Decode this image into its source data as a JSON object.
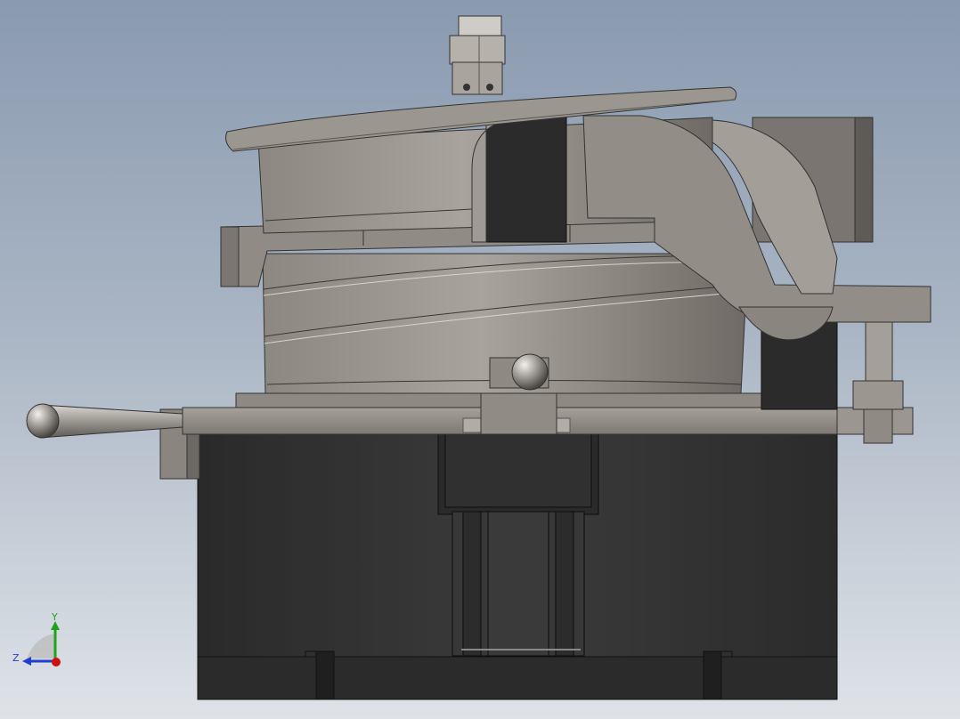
{
  "scene": {
    "background_top": "#8a9ab0",
    "background_bottom": "#dfe3e8",
    "metal_light": "#a39f98",
    "metal_mid": "#8c8780",
    "metal_dark": "#5f5b57",
    "base_color": "#2f2f2f"
  },
  "triad": {
    "y_label": "Y",
    "z_label": "Z",
    "y_color": "#1fa31f",
    "z_color": "#1f3fcf",
    "x_color": "#d01010"
  }
}
